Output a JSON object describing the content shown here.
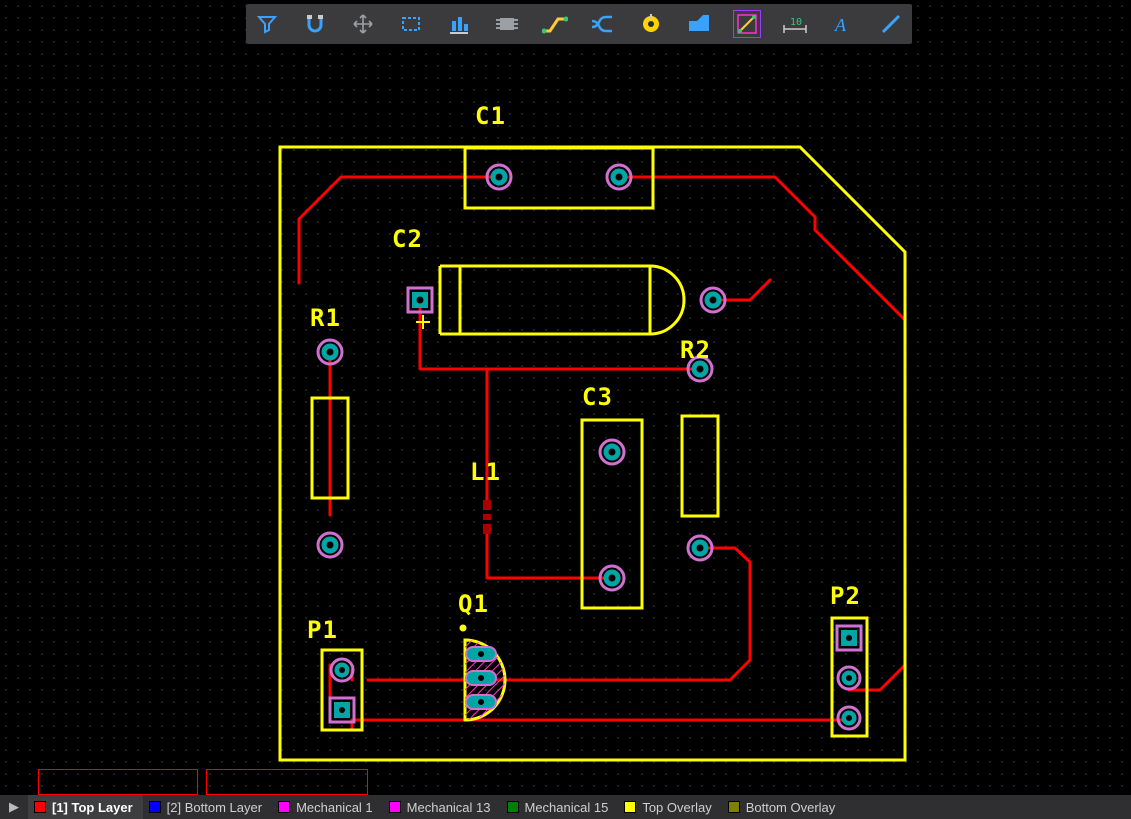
{
  "toolbar": {
    "icons": [
      "filter",
      "snap",
      "move",
      "select-rect",
      "align",
      "component",
      "route",
      "diff-pair",
      "via",
      "plane",
      "draw-line",
      "dimension",
      "text",
      "line"
    ]
  },
  "designators": {
    "c1": "C1",
    "c2": "C2",
    "c3": "C3",
    "r1": "R1",
    "r2": "R2",
    "l1": "L1",
    "q1": "Q1",
    "p1": "P1",
    "p2": "P2"
  },
  "layers": [
    {
      "label": "[1] Top Layer",
      "color": "#ff0000",
      "active": true
    },
    {
      "label": "[2] Bottom Layer",
      "color": "#0000ff",
      "active": false
    },
    {
      "label": "Mechanical 1",
      "color": "#ff00ff",
      "active": false
    },
    {
      "label": "Mechanical 13",
      "color": "#ff00ff",
      "active": false
    },
    {
      "label": "Mechanical 15",
      "color": "#008000",
      "active": false
    },
    {
      "label": "Top Overlay",
      "color": "#ffff00",
      "active": false
    },
    {
      "label": "Bottom Overlay",
      "color": "#808000",
      "active": false
    }
  ],
  "layer_arrow": "▶"
}
